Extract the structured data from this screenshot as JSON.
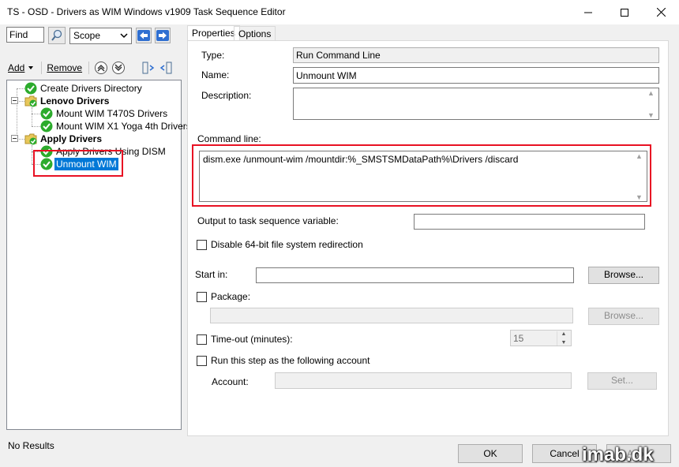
{
  "window": {
    "title": "TS - OSD - Drivers as WIM Windows v1909 Task Sequence Editor"
  },
  "toolbar": {
    "find_value": "Find",
    "scope_value": "Scope",
    "add_label": "Add",
    "remove_label": "Remove"
  },
  "tree": {
    "items": [
      {
        "label": "Create Drivers Directory"
      },
      {
        "label": "Lenovo Drivers"
      },
      {
        "label": "Mount WIM T470S Drivers"
      },
      {
        "label": "Mount WIM X1 Yoga 4th Drivers"
      },
      {
        "label": "Apply Drivers"
      },
      {
        "label": "Apply Drivers Using DISM"
      },
      {
        "label": "Unmount WIM"
      }
    ]
  },
  "status": {
    "text": "No Results"
  },
  "tabs": [
    {
      "label": "Properties"
    },
    {
      "label": "Options"
    }
  ],
  "properties": {
    "type_label": "Type:",
    "type_value": "Run Command Line",
    "name_label": "Name:",
    "name_value": "Unmount WIM",
    "description_label": "Description:",
    "description_value": "",
    "command_line_label": "Command line:",
    "command_line_value": "dism.exe /unmount-wim /mountdir:%_SMSTSMDataPath%\\Drivers /discard",
    "output_var_label": "Output to task sequence variable:",
    "output_var_value": "",
    "disable64_label": "Disable 64-bit file system redirection",
    "start_in_label": "Start in:",
    "start_in_value": "",
    "browse_label": "Browse...",
    "package_label": "Package:",
    "package_value": "",
    "package_browse_label": "Browse...",
    "timeout_label": "Time-out (minutes):",
    "timeout_value": "15",
    "run_as_label": "Run this step as the following account",
    "account_label": "Account:",
    "account_value": "",
    "set_label": "Set..."
  },
  "footer": {
    "ok_label": "OK",
    "cancel_label": "Cancel",
    "apply_label": "Apply",
    "watermark": "imab.dk"
  },
  "colors": {
    "selection": "#0078d7",
    "highlight_box": "#e81123",
    "check_green": "#2cab2c"
  }
}
